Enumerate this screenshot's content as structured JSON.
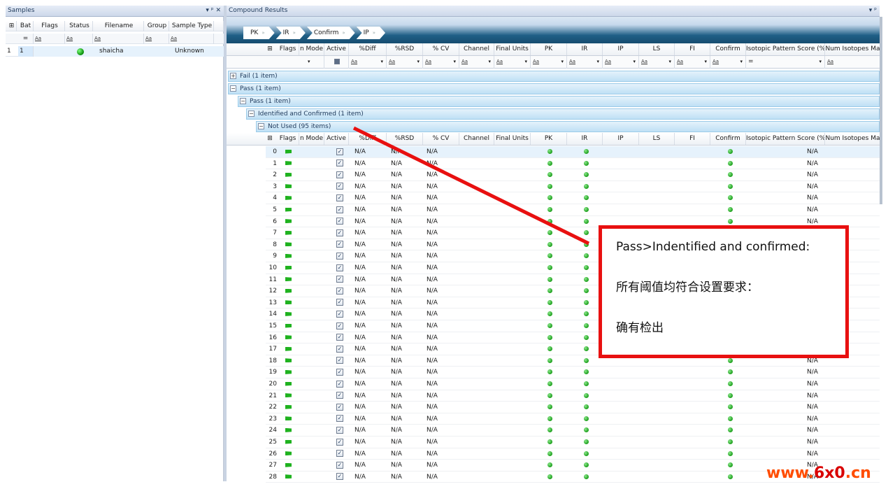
{
  "samples_panel": {
    "title": "Samples",
    "controls": "▾ ᵖ ✕",
    "columns": [
      "Bat",
      "Flags",
      "Status",
      "Filename",
      "Group",
      "Sample Type"
    ],
    "filter_eq": "=",
    "filter_aa": "Aa",
    "rows": [
      {
        "index": "1",
        "batch": "1",
        "filename": "shaicha",
        "sample_type": "Unknown"
      }
    ]
  },
  "compound_panel": {
    "title": "Compound Results",
    "controls": "▾ ᵖ",
    "breadcrumbs": [
      "PK",
      "IR",
      "Confirm",
      "IP"
    ],
    "columns": [
      "Flags",
      "n Mode",
      "Active",
      "%Diff",
      "%RSD",
      "% CV",
      "Channel",
      "Final Units",
      "PK",
      "IR",
      "IP",
      "LS",
      "FI",
      "Confirm",
      "Isotopic Pattern Score (%)",
      "Num Isotopes Ma"
    ],
    "filter_eq": "=",
    "filter_aa": "Aa",
    "groups": [
      {
        "label": "Fail (1 item)",
        "toggle": "+"
      },
      {
        "label": "Pass (1 item)",
        "toggle": "−"
      },
      {
        "label": "Pass (1 item)",
        "toggle": "−"
      },
      {
        "label": "Identified and Confirmed (1 item)",
        "toggle": "−"
      },
      {
        "label": "Not Used (95 items)",
        "toggle": "−"
      }
    ],
    "na": "N/A",
    "check": "✓",
    "row_indices": [
      "0",
      "1",
      "2",
      "3",
      "4",
      "5",
      "6",
      "7",
      "8",
      "9",
      "10",
      "11",
      "12",
      "13",
      "14",
      "15",
      "16",
      "17",
      "18",
      "19",
      "20",
      "21",
      "22",
      "23",
      "24",
      "25",
      "26",
      "27",
      "28"
    ]
  },
  "annotation": {
    "line1": "Pass>Indentified and confirmed:",
    "line2": "所有阈值均符合设置要求：",
    "line3": "确有检出",
    "color": "#e81010"
  },
  "watermark": {
    "part1": "www.",
    "part2": "6x0",
    "part3": ".cn"
  }
}
